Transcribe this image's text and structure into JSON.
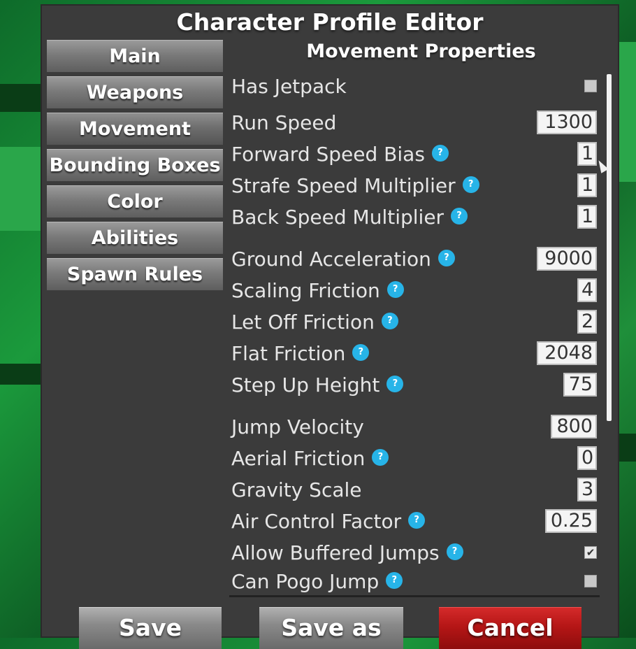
{
  "window": {
    "title": "Character Profile Editor"
  },
  "nav": [
    {
      "label": "Main"
    },
    {
      "label": "Weapons"
    },
    {
      "label": "Movement"
    },
    {
      "label": "Bounding Boxes"
    },
    {
      "label": "Color"
    },
    {
      "label": "Abilities"
    },
    {
      "label": "Spawn Rules"
    }
  ],
  "section_title": "Movement Properties",
  "fields": [
    {
      "label": "Has Jetpack",
      "type": "checkbox",
      "checked": false,
      "help": false
    },
    {
      "label": "Run Speed",
      "type": "number",
      "value": "1300",
      "help": false
    },
    {
      "label": "Forward Speed Bias",
      "type": "number",
      "value": "1",
      "help": true
    },
    {
      "label": "Strafe Speed Multiplier",
      "type": "number",
      "value": "1",
      "help": true
    },
    {
      "label": "Back Speed Multiplier",
      "type": "number",
      "value": "1",
      "help": true
    },
    {
      "label": "Ground Acceleration",
      "type": "number",
      "value": "9000",
      "help": true
    },
    {
      "label": "Scaling Friction",
      "type": "number",
      "value": "4",
      "help": true
    },
    {
      "label": "Let Off Friction",
      "type": "number",
      "value": "2",
      "help": true
    },
    {
      "label": "Flat Friction",
      "type": "number",
      "value": "2048",
      "help": true
    },
    {
      "label": "Step Up Height",
      "type": "number",
      "value": "75",
      "help": true
    },
    {
      "label": "Jump Velocity",
      "type": "number",
      "value": "800",
      "help": false
    },
    {
      "label": "Aerial Friction",
      "type": "number",
      "value": "0",
      "help": true
    },
    {
      "label": "Gravity Scale",
      "type": "number",
      "value": "3",
      "help": false
    },
    {
      "label": "Air Control Factor",
      "type": "number",
      "value": "0.25",
      "help": true
    },
    {
      "label": "Allow Buffered Jumps",
      "type": "checkbox",
      "checked": true,
      "help": true
    },
    {
      "label": "Can Pogo Jump",
      "type": "checkbox",
      "checked": false,
      "help": true
    }
  ],
  "buttons": {
    "save": "Save",
    "save_as": "Save as",
    "cancel": "Cancel"
  },
  "icons": {
    "help": "help-question-icon",
    "check": "checkmark-icon"
  },
  "colors": {
    "help_badge": "#27b4e8",
    "cancel": "#b51616",
    "panel": "#3b3b3b"
  }
}
